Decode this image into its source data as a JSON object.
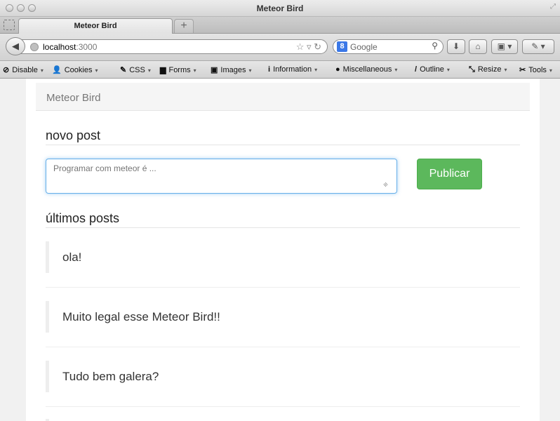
{
  "window": {
    "title": "Meteor Bird"
  },
  "tabs": [
    {
      "label": "Meteor Bird"
    }
  ],
  "new_tab_label": "+",
  "address": {
    "host": "localhost",
    "port": ":3000"
  },
  "search": {
    "engine": "Google",
    "engine_icon": "8"
  },
  "devbar": [
    {
      "label": "Disable",
      "icon": "⊘"
    },
    {
      "label": "Cookies",
      "icon": "👤"
    },
    {
      "label": "CSS",
      "icon": "✎"
    },
    {
      "label": "Forms",
      "icon": "▆"
    },
    {
      "label": "Images",
      "icon": "▣"
    },
    {
      "label": "Information",
      "icon": "i"
    },
    {
      "label": "Miscellaneous",
      "icon": "●"
    },
    {
      "label": "Outline",
      "icon": "/"
    },
    {
      "label": "Resize",
      "icon": "⤡"
    },
    {
      "label": "Tools",
      "icon": "✂"
    }
  ],
  "app": {
    "brand": "Meteor Bird",
    "new_post_heading": "novo post",
    "input_placeholder": "Programar com meteor é ...",
    "publish_label": "Publicar",
    "latest_heading": "últimos posts",
    "posts": [
      {
        "text": "ola!"
      },
      {
        "text": "Muito legal esse Meteor Bird!!"
      },
      {
        "text": "Tudo bem galera?"
      }
    ]
  },
  "colors": {
    "accent": "#5cb85c",
    "focus": "#66afe9"
  }
}
